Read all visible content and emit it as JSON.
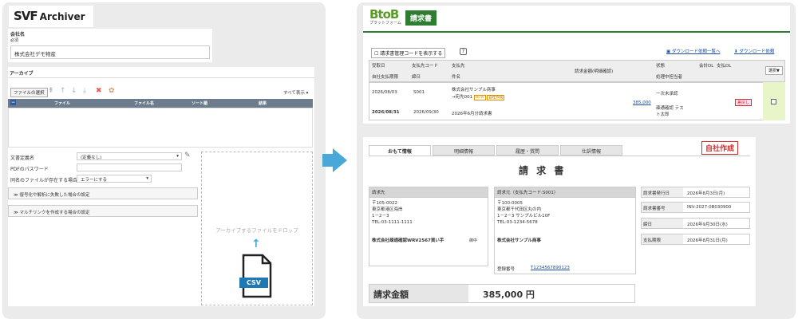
{
  "left": {
    "logo_svf": "SVF",
    "logo_archiver": "Archiver",
    "company_label": "会社名",
    "required_label": "必須",
    "company_value": "株式会社デモ物産",
    "archive_label": "アーカイブ",
    "file_select_btn": "ファイルの選択",
    "show_all": "すべて表示",
    "columns": [
      "ファイル",
      "ファイル名",
      "ソート順",
      "結果"
    ],
    "doc_def_label": "文書定義名",
    "doc_def_value": "(定義なし)",
    "pdf_pw_label": "PDFのパスワード",
    "same_name_label": "同名のファイルが存在する場合",
    "same_name_value": "エラーにする",
    "decrypt_fail": "復号化や解析に失敗した場合の設定",
    "multilink": "マルチリンクを作成する場合の設定",
    "drop_text": "アーカイブするファイルをドロップ",
    "csv_label": "CSV"
  },
  "right": {
    "btob_brand": "BtoB",
    "btob_sub": "プラットフォーム",
    "seikyu": "請求書",
    "show_code": "請求書管理コードを表示する",
    "help": "?",
    "dl_list": "ダウンロード依頼一覧へ",
    "dl_req": "ダウンロード依頼",
    "head_row1": [
      "受取日",
      "支払先コード",
      "支払先",
      "請求金額(明細確認)",
      "状態",
      "会計DL",
      "支払DL"
    ],
    "head_row2": [
      "自社支払期限",
      "締日",
      "件名",
      "処理中担当者"
    ],
    "select_btn": "選択▼",
    "rec": {
      "date1": "2026/08/03",
      "code": "S001",
      "payee": "株式会社サンプル商事",
      "to": "→宛先001",
      "new": "NEW",
      "own": "自社作成",
      "status": "一次未承認",
      "date2": "2026/08/31",
      "close": "2026/09/30",
      "subject": "2026年6月分請求書",
      "amount": "385,000",
      "handler": "疎通確認 テスト太郎",
      "reject": "差戻し"
    },
    "tabs": [
      "おもて情報",
      "明細情報",
      "履歴・質問",
      "仕訳情報"
    ],
    "stamp": "自社作成",
    "doc_title": "請 求 書",
    "billto_h": "請求先",
    "billto_lines": [
      "〒105-0022",
      "東京都港区海岸",
      "1－2－3",
      "TEL:03-1111-1111"
    ],
    "billto_name": "株式会社疎通確認WRV2567買い手",
    "onchu": "御中",
    "from_h": "請求元（支払先コード:S001）",
    "from_lines": [
      "〒100-0005",
      "東京都千代田区丸の内",
      "1－2－3 サンプルビル10F",
      "TEL:03-1234-5678"
    ],
    "from_name": "株式会社サンプル商事",
    "reg_label": "登録番号",
    "reg_no": "T1234567890123",
    "kv": [
      [
        "請求書発行日",
        "2026年8月3日(月)"
      ],
      [
        "請求書番号",
        "INV-2027-0B030900"
      ],
      [
        "締日",
        "2026年9月30日(水)"
      ],
      [
        "支払期限",
        "2026年8月31日(月)"
      ]
    ],
    "total_label": "請求金額",
    "total_value": "385,000 円"
  },
  "colors": {
    "accent": "#4aa8d8",
    "green": "#2e7d32",
    "red": "#d32f2f"
  }
}
